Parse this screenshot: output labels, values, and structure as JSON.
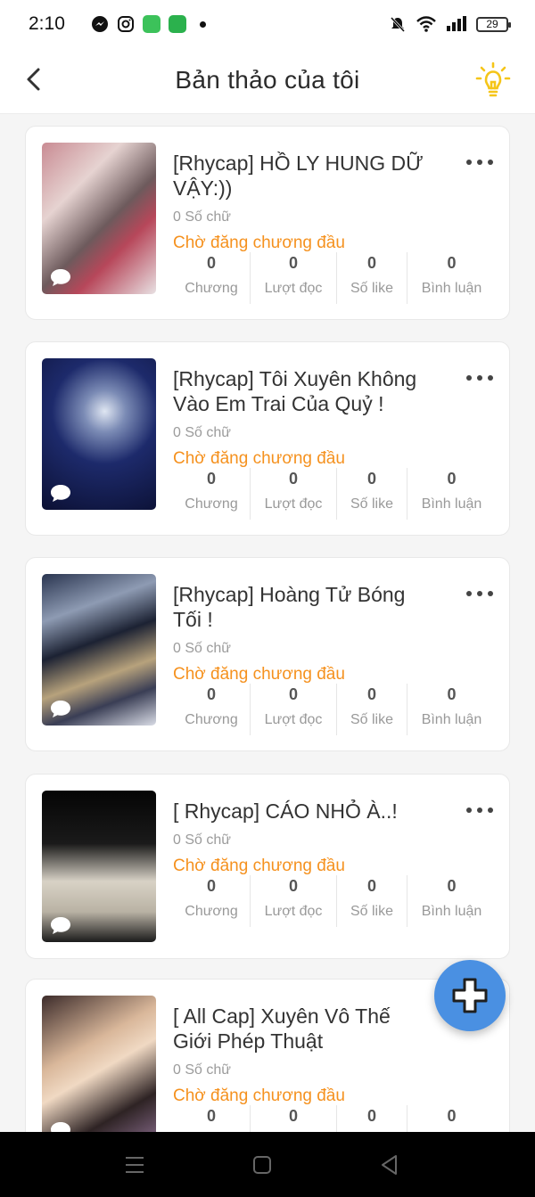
{
  "status_bar": {
    "time": "2:10",
    "battery": "29",
    "icons": [
      "messenger-icon",
      "instagram-icon",
      "app-icon",
      "chat-icon",
      "silent-icon",
      "wifi-icon",
      "signal-icon"
    ]
  },
  "header": {
    "title": "Bản thảo của tôi",
    "accent_color": "#f5c518"
  },
  "stat_labels": {
    "chapters": "Chương",
    "reads": "Lượt đọc",
    "likes": "Số like",
    "comments": "Bình luận"
  },
  "drafts": [
    {
      "title": "[Rhycap] HỒ LY HUNG DỮ VẬY:))",
      "word_count": "0 Số chữ",
      "status": "Chờ đăng chương đầu",
      "chapters": "0",
      "reads": "0",
      "likes": "0",
      "comments": "0"
    },
    {
      "title": "[Rhycap] Tôi Xuyên Không Vào Em Trai Của Quỷ !",
      "word_count": "0 Số chữ",
      "status": "Chờ đăng chương đầu",
      "chapters": "0",
      "reads": "0",
      "likes": "0",
      "comments": "0"
    },
    {
      "title": "[Rhycap] Hoàng Tử Bóng Tối !",
      "word_count": "0 Số chữ",
      "status": "Chờ đăng chương đầu",
      "chapters": "0",
      "reads": "0",
      "likes": "0",
      "comments": "0"
    },
    {
      "title": "[ Rhycap] CÁO NHỎ À..!",
      "word_count": "0 Số chữ",
      "status": "Chờ đăng chương đầu",
      "chapters": "0",
      "reads": "0",
      "likes": "0",
      "comments": "0"
    },
    {
      "title": "[ All Cap] Xuyên Vô Thế Giới Phép Thuật",
      "word_count": "0 Số chữ",
      "status": "Chờ đăng chương đầu",
      "chapters": "0",
      "reads": "0",
      "likes": "0",
      "comments": "0"
    }
  ],
  "colors": {
    "status_text": "#f5911e",
    "fab": "#4a90e2"
  }
}
